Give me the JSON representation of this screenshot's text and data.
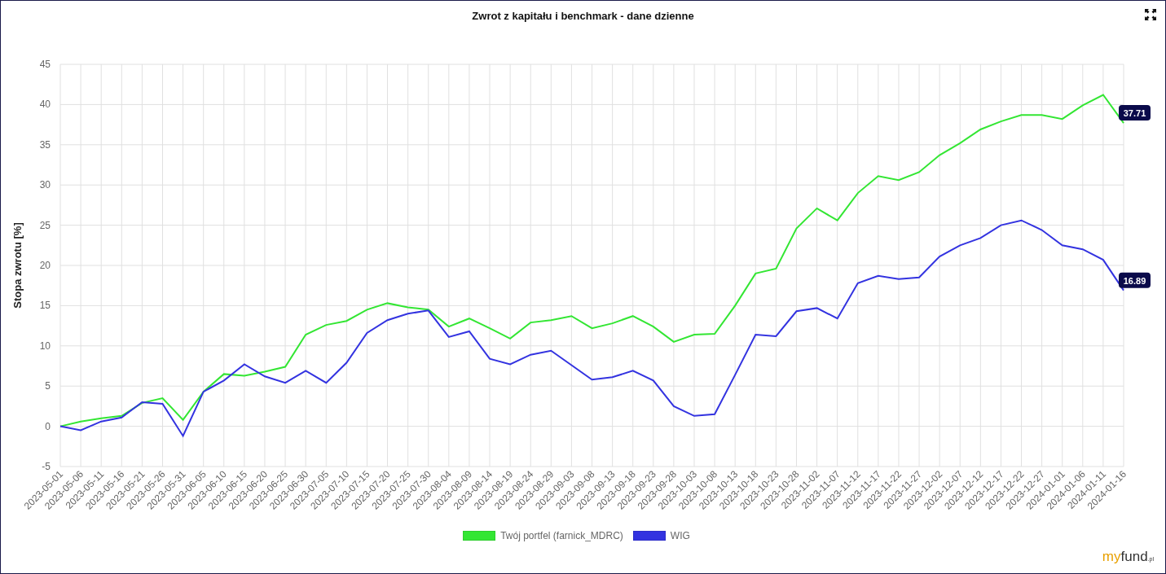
{
  "title": "Zwrot z kapitału i benchmark - dane dzienne",
  "chart_data": {
    "type": "line",
    "ylabel": "Stopa zwrotu [%]",
    "ylim": [
      -5,
      45
    ],
    "yticks": [
      -5,
      0,
      5,
      10,
      15,
      20,
      25,
      30,
      35,
      40,
      45
    ],
    "categories": [
      "2023-05-01",
      "2023-05-06",
      "2023-05-11",
      "2023-05-16",
      "2023-05-21",
      "2023-05-26",
      "2023-05-31",
      "2023-06-05",
      "2023-06-10",
      "2023-06-15",
      "2023-06-20",
      "2023-06-25",
      "2023-06-30",
      "2023-07-05",
      "2023-07-10",
      "2023-07-15",
      "2023-07-20",
      "2023-07-25",
      "2023-07-30",
      "2023-08-04",
      "2023-08-09",
      "2023-08-14",
      "2023-08-19",
      "2023-08-24",
      "2023-08-29",
      "2023-09-03",
      "2023-09-08",
      "2023-09-13",
      "2023-09-18",
      "2023-09-23",
      "2023-09-28",
      "2023-10-03",
      "2023-10-08",
      "2023-10-13",
      "2023-10-18",
      "2023-10-23",
      "2023-10-28",
      "2023-11-02",
      "2023-11-07",
      "2023-11-12",
      "2023-11-17",
      "2023-11-22",
      "2023-11-27",
      "2023-12-02",
      "2023-12-07",
      "2023-12-12",
      "2023-12-17",
      "2023-12-22",
      "2023-12-27",
      "2024-01-01",
      "2024-01-06",
      "2024-01-11",
      "2024-01-16"
    ],
    "series": [
      {
        "name": "Twój portfel (farnick_MDRC)",
        "color": "#33e633",
        "values": [
          0,
          0.6,
          1.0,
          1.3,
          2.9,
          3.5,
          0.8,
          4.3,
          6.5,
          6.3,
          6.8,
          7.4,
          11.4,
          12.6,
          13.1,
          14.5,
          15.3,
          14.8,
          14.5,
          12.4,
          13.4,
          12.2,
          10.9,
          12.9,
          13.2,
          13.7,
          12.2,
          12.8,
          13.7,
          12.4,
          10.5,
          11.4,
          11.5,
          15.0,
          19.0,
          19.6,
          24.6,
          27.1,
          25.6,
          29.0,
          31.1,
          30.6,
          31.6,
          33.7,
          35.2,
          36.9,
          37.9,
          38.7,
          38.7,
          38.2,
          39.9,
          41.2,
          37.7
        ]
      },
      {
        "name": "WIG",
        "color": "#3333e0",
        "values": [
          0,
          -0.5,
          0.6,
          1.1,
          3.0,
          2.8,
          -1.2,
          4.3,
          5.7,
          7.7,
          6.2,
          5.4,
          6.9,
          5.4,
          7.9,
          11.6,
          13.2,
          14.0,
          14.4,
          11.1,
          11.8,
          8.4,
          7.7,
          8.9,
          9.4,
          7.6,
          5.8,
          6.1,
          6.9,
          5.7,
          2.5,
          1.3,
          1.5,
          6.4,
          11.4,
          11.2,
          14.3,
          14.7,
          13.4,
          17.8,
          18.7,
          18.3,
          18.5,
          21.1,
          22.5,
          23.4,
          25.0,
          25.6,
          24.4,
          22.5,
          22.0,
          20.7,
          16.9
        ]
      }
    ],
    "grid": true,
    "annotations": [
      {
        "x": "2024-01-16",
        "y": 37.7,
        "text": "37.71"
      },
      {
        "x": "2024-01-16",
        "y": 16.9,
        "text": "16.89"
      }
    ]
  },
  "logo": {
    "part_1": "my",
    "part_2": "fund",
    "part_3": ".pl"
  }
}
